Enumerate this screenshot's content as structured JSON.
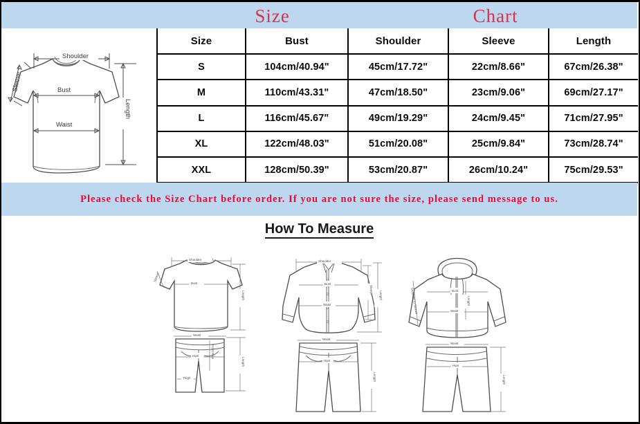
{
  "header": {
    "title_left": "Size",
    "title_right": "Chart",
    "title_color": "#d6334c",
    "background_color": "#bdd7ee"
  },
  "size_table": {
    "columns": [
      "Size",
      "Bust",
      "Shoulder",
      "Sleeve",
      "Length"
    ],
    "rows": [
      {
        "size": "S",
        "bust": "104cm/40.94\"",
        "shoulder": "45cm/17.72\"",
        "sleeve": "22cm/8.66\"",
        "length": "67cm/26.38\""
      },
      {
        "size": "M",
        "bust": "110cm/43.31\"",
        "shoulder": "47cm/18.50\"",
        "sleeve": "23cm/9.06\"",
        "length": "69cm/27.17\""
      },
      {
        "size": "L",
        "bust": "116cm/45.67\"",
        "shoulder": "49cm/19.29\"",
        "sleeve": "24cm/9.45\"",
        "length": "71cm/27.95\""
      },
      {
        "size": "XL",
        "bust": "122cm/48.03\"",
        "shoulder": "51cm/20.08\"",
        "sleeve": "25cm/9.84\"",
        "length": "73cm/28.74\""
      },
      {
        "size": "XXL",
        "bust": "128cm/50.39\"",
        "shoulder": "53cm/20.87\"",
        "sleeve": "26cm/10.24\"",
        "length": "75cm/29.53\""
      }
    ]
  },
  "notice": {
    "text": "Please check the Size Chart before order. If you are not sure the size, please send message to us.",
    "color": "#ff0033",
    "background_color": "#bdd7ee"
  },
  "measure_section": {
    "heading": "How To Measure",
    "tshirt_diagram": {
      "labels": [
        "Shoulder",
        "Sleeve",
        "Bust",
        "Waist",
        "Length"
      ]
    },
    "diagrams": [
      {
        "name": "tshirt-and-shorts",
        "top_labels": [
          "Shoulder",
          "Sleeve",
          "Bust",
          "Length"
        ],
        "bottom_labels": [
          "Waist",
          "Hips",
          "Front Rise",
          "Thigh",
          "Length"
        ]
      },
      {
        "name": "shirt-and-pants",
        "top_labels": [
          "Shoulder",
          "Bust",
          "Waist",
          "Sleeve",
          "Length"
        ],
        "bottom_labels": [
          "Waist",
          "Hips",
          "Length"
        ]
      },
      {
        "name": "hoodie-and-sweatpants",
        "top_labels": [
          "Shoulder to Sleeve",
          "Bust",
          "Waist",
          "Length"
        ],
        "bottom_labels": [
          "Waist",
          "Hips",
          "Length"
        ]
      }
    ]
  }
}
